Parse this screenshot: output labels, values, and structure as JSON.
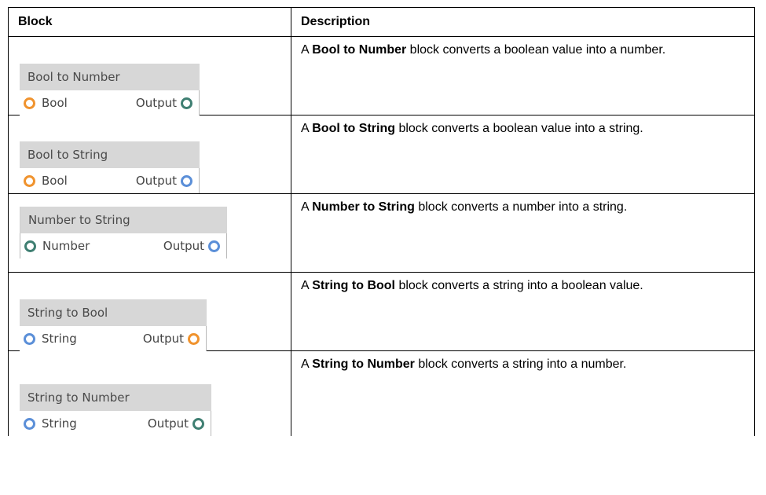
{
  "table": {
    "header": {
      "block": "Block",
      "description": "Description"
    },
    "rows": [
      {
        "block": {
          "title": "Bool to Number",
          "input_label": "Bool",
          "output_label": "Output",
          "input_icon": "orange-circle-port-icon",
          "output_icon": "teal-circle-port-icon",
          "input_color": "#f0932e",
          "output_color": "#3f7f72"
        },
        "desc_prefix": "A ",
        "desc_bold": "Bool to Number",
        "desc_suffix": " block converts a boolean value into a number."
      },
      {
        "block": {
          "title": "Bool to String",
          "input_label": "Bool",
          "output_label": "Output",
          "input_icon": "orange-circle-port-icon",
          "output_icon": "blue-circle-port-icon",
          "input_color": "#f0932e",
          "output_color": "#5b8fd8"
        },
        "desc_prefix": "A ",
        "desc_bold": "Bool to String",
        "desc_suffix": " block converts a boolean value into a string."
      },
      {
        "block": {
          "title": "Number to String",
          "input_label": "Number",
          "output_label": "Output",
          "input_icon": "teal-circle-port-icon",
          "output_icon": "blue-circle-port-icon",
          "input_color": "#3f7f72",
          "output_color": "#5b8fd8"
        },
        "desc_prefix": "A ",
        "desc_bold": "Number to String",
        "desc_suffix": " block converts a number into a string."
      },
      {
        "block": {
          "title": "String to Bool",
          "input_label": "String",
          "output_label": "Output",
          "input_icon": "blue-circle-port-icon",
          "output_icon": "orange-circle-port-icon",
          "input_color": "#5b8fd8",
          "output_color": "#f0932e"
        },
        "desc_prefix": "A ",
        "desc_bold": "String to Bool",
        "desc_suffix": " block converts a string into a boolean value."
      },
      {
        "block": {
          "title": "String to Number",
          "input_label": "String",
          "output_label": "Output",
          "input_icon": "blue-circle-port-icon",
          "output_icon": "teal-circle-port-icon",
          "input_color": "#5b8fd8",
          "output_color": "#3f7f72"
        },
        "desc_prefix": "A ",
        "desc_bold": "String to Number",
        "desc_suffix": " block converts a string into a number."
      }
    ]
  }
}
